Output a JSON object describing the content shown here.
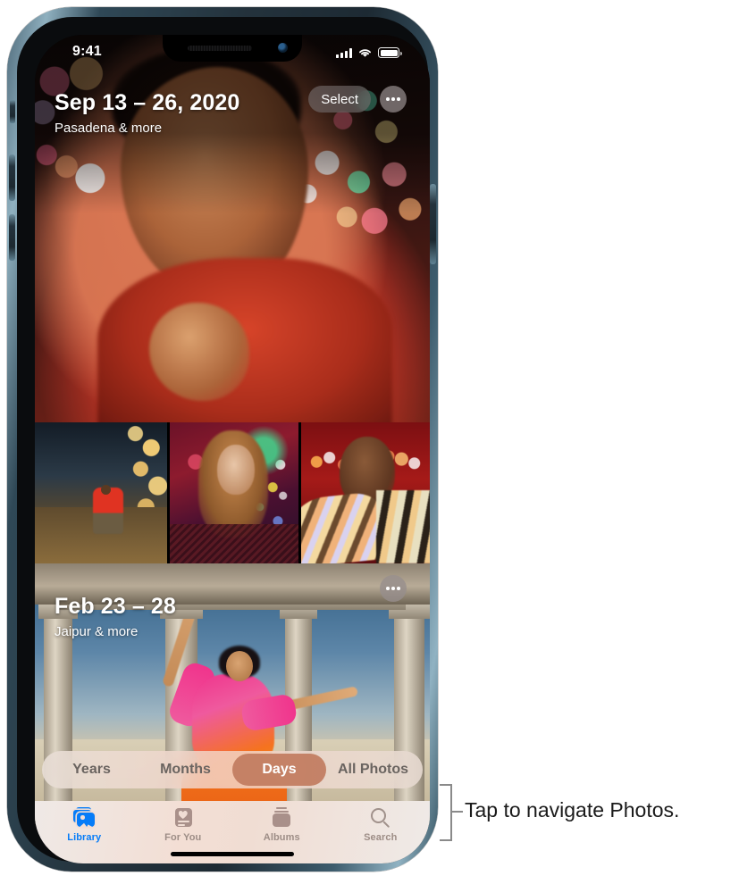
{
  "status_bar": {
    "time": "9:41",
    "cellular_icon": "signal-bars-icon",
    "wifi_icon": "wifi-icon",
    "battery_icon": "battery-icon"
  },
  "day_groups": [
    {
      "date_range": "Sep 13 – 26, 2020",
      "location": "Pasadena & more",
      "select_label": "Select",
      "more_icon": "ellipsis-icon"
    },
    {
      "date_range": "Feb 23 – 28",
      "location": "Jaipur & more",
      "more_icon": "ellipsis-icon"
    }
  ],
  "segmented_control": {
    "options": [
      "Years",
      "Months",
      "Days",
      "All Photos"
    ],
    "selected": "Days",
    "selected_bg": "#c17c5f"
  },
  "tab_bar": {
    "tabs": [
      {
        "label": "Library",
        "icon": "photo-stack-icon",
        "active": true
      },
      {
        "label": "For You",
        "icon": "for-you-card-icon",
        "active": false
      },
      {
        "label": "Albums",
        "icon": "albums-stack-icon",
        "active": false
      },
      {
        "label": "Search",
        "icon": "magnifier-icon",
        "active": false
      }
    ],
    "active_color": "#067cf8",
    "inactive_color": "#9d8d86"
  },
  "callout": {
    "text": "Tap to navigate Photos.",
    "bracket_color": "#8a8a8a"
  }
}
